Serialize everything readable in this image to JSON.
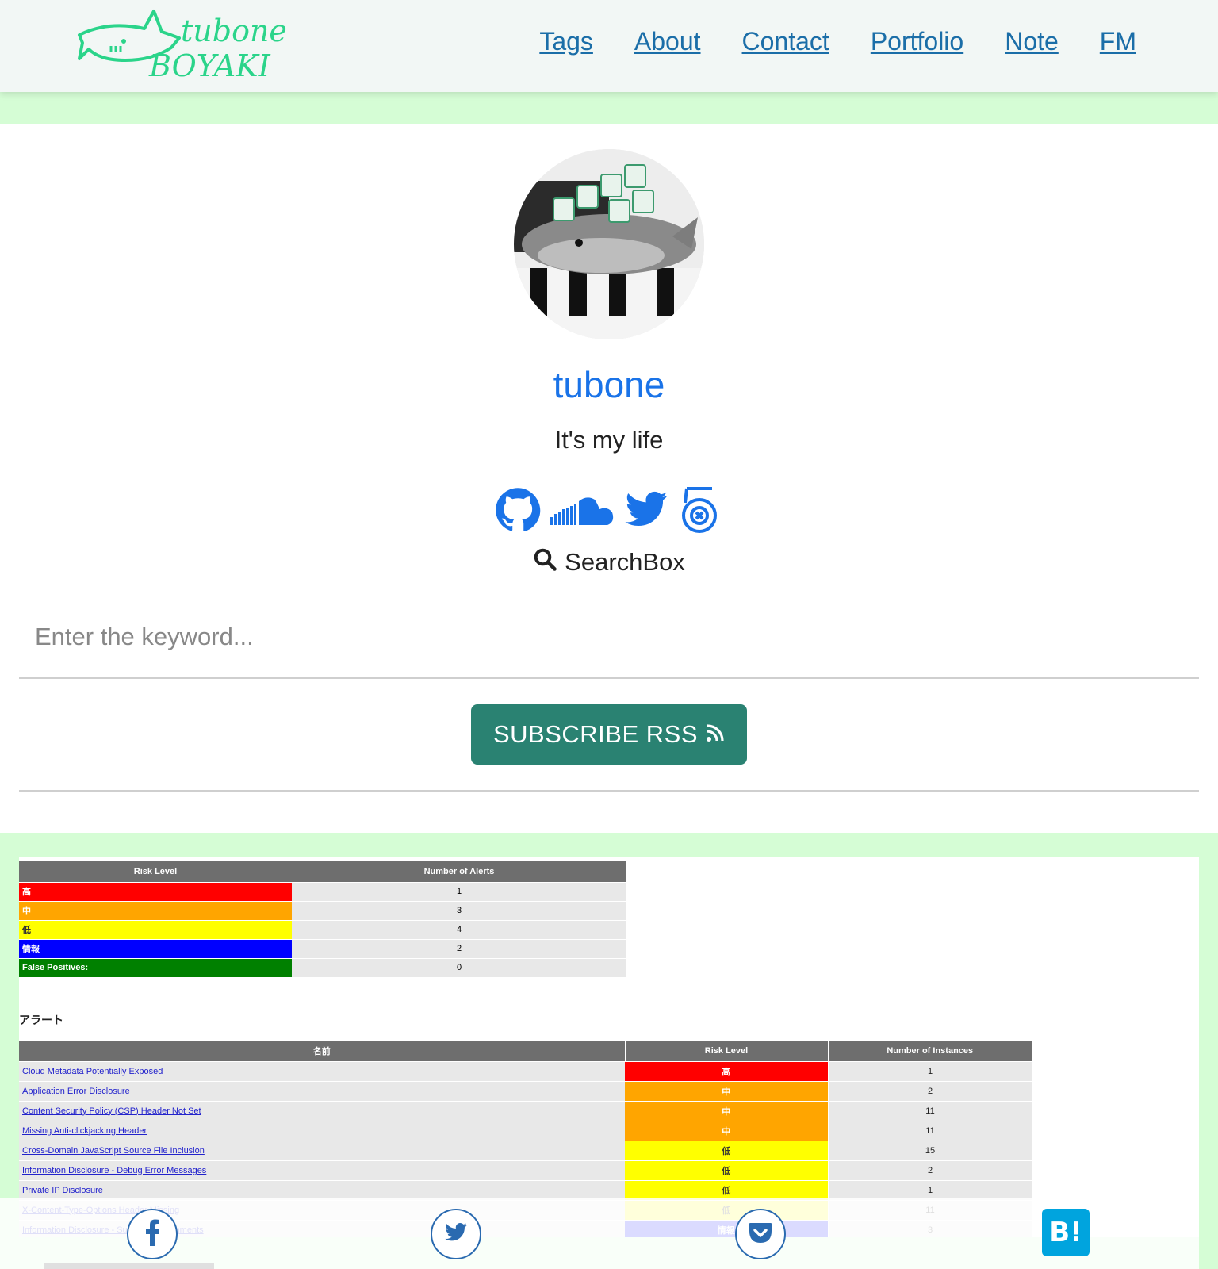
{
  "site": {
    "logo_line1": "tubone",
    "logo_line2": "BOYAKI"
  },
  "nav": {
    "items": [
      "Tags",
      "About",
      "Contact",
      "Portfolio",
      "Note",
      "FM"
    ]
  },
  "profile": {
    "name": "tubone",
    "tagline": "It's my life",
    "social_icons": [
      "github-icon",
      "soundcloud-icon",
      "twitter-icon",
      "500px-icon"
    ]
  },
  "search": {
    "label": "SearchBox",
    "placeholder": "Enter the keyword..."
  },
  "rss": {
    "label": "SUBSCRIBE RSS"
  },
  "thumbnail": {
    "summary_headers": [
      "Risk Level",
      "Number of Alerts"
    ],
    "summary_rows": [
      {
        "level": "高",
        "count": "1",
        "color": "#ff0000"
      },
      {
        "level": "中",
        "count": "3",
        "color": "#ffa500"
      },
      {
        "level": "低",
        "count": "4",
        "color": "#ffff00"
      },
      {
        "level": "情報",
        "count": "2",
        "color": "#0000ff"
      },
      {
        "level": "False Positives:",
        "count": "0",
        "color": "#008000"
      }
    ],
    "alerts_heading": "アラート",
    "alert_headers": [
      "名前",
      "Risk Level",
      "Number of Instances"
    ],
    "alert_rows": [
      {
        "name": "Cloud Metadata Potentially Exposed",
        "risk": "高",
        "instances": "1",
        "color": "#ff0000"
      },
      {
        "name": "Application Error Disclosure",
        "risk": "中",
        "instances": "2",
        "color": "#ffa500"
      },
      {
        "name": "Content Security Policy (CSP) Header Not Set",
        "risk": "中",
        "instances": "11",
        "color": "#ffa500"
      },
      {
        "name": "Missing Anti-clickjacking Header",
        "risk": "中",
        "instances": "11",
        "color": "#ffa500"
      },
      {
        "name": "Cross-Domain JavaScript Source File Inclusion",
        "risk": "低",
        "instances": "15",
        "color": "#ffff00"
      },
      {
        "name": "Information Disclosure - Debug Error Messages",
        "risk": "低",
        "instances": "2",
        "color": "#ffff00"
      },
      {
        "name": "Private IP Disclosure",
        "risk": "低",
        "instances": "1",
        "color": "#ffff00"
      },
      {
        "name": "X-Content-Type-Options Header Missing",
        "risk": "低",
        "instances": "11",
        "color": "#ffff00"
      },
      {
        "name": "Information Disclosure - Suspicious Comments",
        "risk": "情報",
        "instances": "3",
        "color": "#0000ff"
      }
    ]
  },
  "share": {
    "buttons": [
      "facebook-icon",
      "twitter-icon",
      "pocket-icon",
      "hatena-bookmark-icon"
    ],
    "hatena_label": "B!"
  },
  "colors": {
    "accent_green": "#2a8272",
    "band_green": "#d5fdd5",
    "link_blue": "#1b6ea8",
    "name_blue": "#1a73e8"
  }
}
